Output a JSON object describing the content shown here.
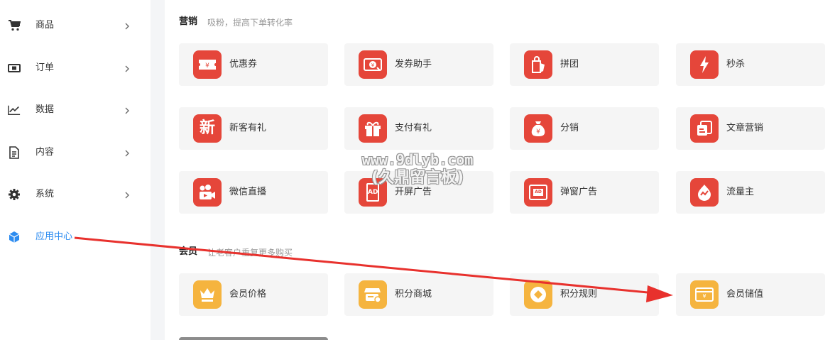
{
  "sidebar": {
    "items": [
      {
        "label": "商品",
        "icon": "cart-icon",
        "active": false
      },
      {
        "label": "订单",
        "icon": "money-icon",
        "active": false
      },
      {
        "label": "数据",
        "icon": "chart-line-icon",
        "active": false
      },
      {
        "label": "内容",
        "icon": "document-icon",
        "active": false
      },
      {
        "label": "系统",
        "icon": "gear-icon",
        "active": false
      },
      {
        "label": "应用中心",
        "icon": "cube-icon",
        "active": true
      }
    ]
  },
  "marketing": {
    "title": "营销",
    "subtitle": "吸粉，提高下单转化率",
    "cards": [
      {
        "label": "优惠券",
        "icon": "coupon-icon"
      },
      {
        "label": "发券助手",
        "icon": "coupon-send-icon"
      },
      {
        "label": "拼团",
        "icon": "group-buy-icon"
      },
      {
        "label": "秒杀",
        "icon": "lightning-icon"
      },
      {
        "label": "新客有礼",
        "icon": "new-customer-icon",
        "glyph": "新"
      },
      {
        "label": "支付有礼",
        "icon": "gift-icon"
      },
      {
        "label": "分销",
        "icon": "money-bag-icon"
      },
      {
        "label": "文章营销",
        "icon": "article-icon"
      },
      {
        "label": "微信直播",
        "icon": "video-camera-icon"
      },
      {
        "label": "开屏广告",
        "icon": "splash-ad-icon",
        "glyph": "AD"
      },
      {
        "label": "弹窗广告",
        "icon": "popup-ad-icon",
        "glyph": "AD"
      },
      {
        "label": "流量主",
        "icon": "traffic-icon"
      }
    ]
  },
  "member": {
    "title": "会员",
    "subtitle": "让老客户重复更多购买",
    "cards": [
      {
        "label": "会员价格",
        "icon": "crown-icon"
      },
      {
        "label": "积分商城",
        "icon": "points-mall-icon"
      },
      {
        "label": "积分规则",
        "icon": "points-rule-icon"
      },
      {
        "label": "会员储值",
        "icon": "wallet-icon",
        "glyph": "¥"
      }
    ]
  },
  "watermark": {
    "line1": "www.9dlyb.com",
    "line2": "(久鼎留言板)"
  },
  "colors": {
    "accent": "#2d8cf0",
    "marketing_icon": "#e5463a",
    "member_icon": "#f5b43f",
    "arrow": "#e8312d"
  }
}
